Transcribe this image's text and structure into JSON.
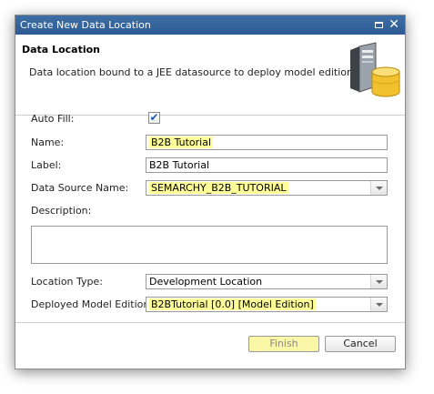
{
  "window": {
    "title": "Create New Data Location",
    "maximize_icon": "maximize-icon",
    "close_icon": "close-icon",
    "close_glyph": "✕"
  },
  "header": {
    "title": "Data Location",
    "description": "Data location bound to a JEE datasource to deploy model editions.",
    "icon": "database-server-icon"
  },
  "form": {
    "auto_fill": {
      "label": "Auto Fill:",
      "checked": true,
      "check_glyph": "✔"
    },
    "name": {
      "label": "Name:",
      "value": "B2B Tutorial"
    },
    "label_field": {
      "label": "Label:",
      "value": "B2B Tutorial"
    },
    "data_source_name": {
      "label": "Data Source Name:",
      "value": "SEMARCHY_B2B_TUTORIAL"
    },
    "description": {
      "label": "Description:",
      "value": ""
    },
    "location_type": {
      "label": "Location Type:",
      "value": "Development Location"
    },
    "deployed_model_edition": {
      "label": "Deployed Model Edition:",
      "value": "B2BTutorial [0.0] [Model Edition]"
    }
  },
  "buttons": {
    "finish": "Finish",
    "cancel": "Cancel"
  },
  "colors": {
    "titlebar": "#2d5a92",
    "highlight": "#ffff99",
    "finish_button": "#fbf7a8",
    "checkmark": "#1f5bb8"
  }
}
